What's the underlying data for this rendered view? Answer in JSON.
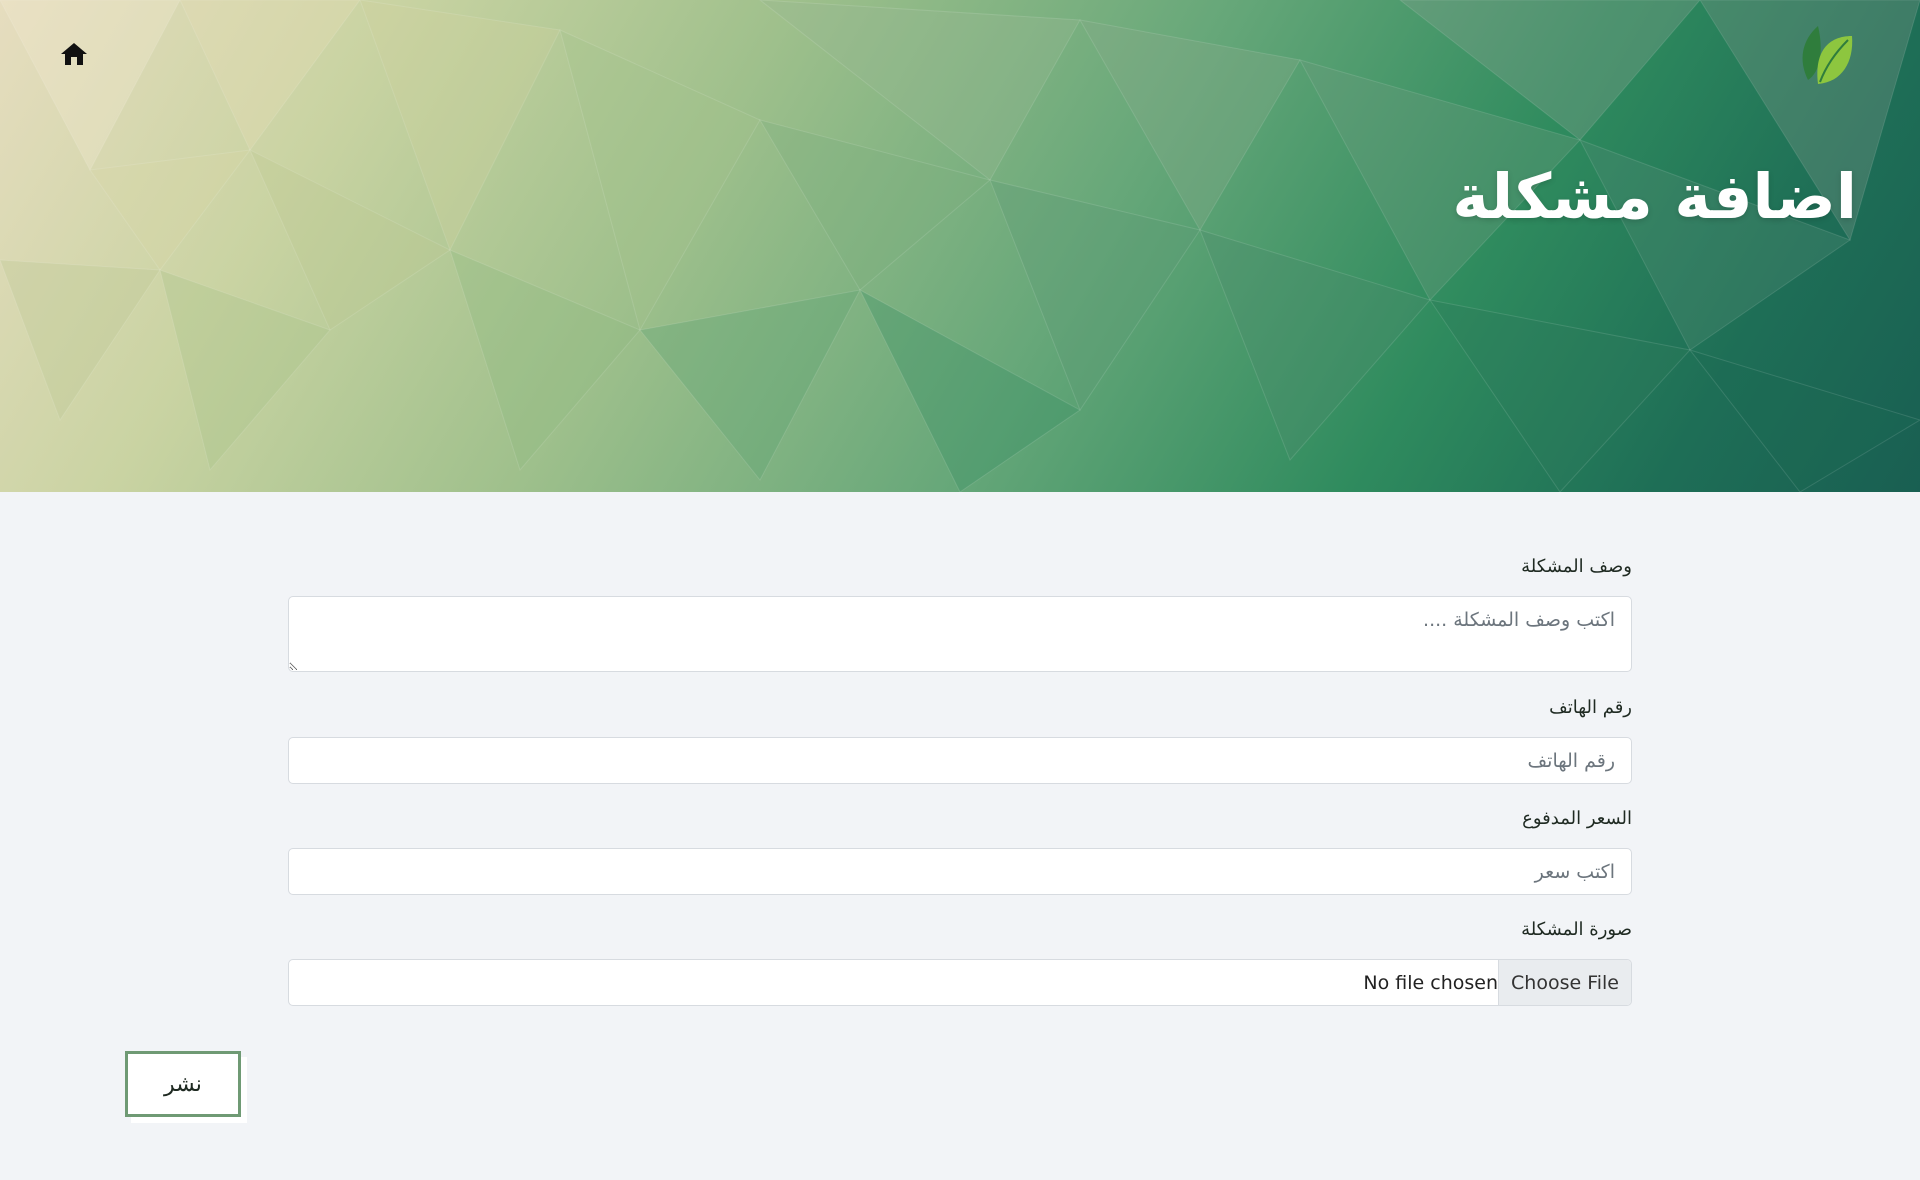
{
  "header": {
    "title": "اضافة مشكلة",
    "home_icon": "home-icon",
    "logo_icon": "leaf-logo-icon"
  },
  "form": {
    "description": {
      "label": "وصف المشكلة",
      "placeholder": "اكتب وصف المشكلة ....",
      "value": ""
    },
    "phone": {
      "label": "رقم الهاتف",
      "placeholder": "رقم الهاتف",
      "value": ""
    },
    "price": {
      "label": "السعر المدفوع",
      "placeholder": "اكتب سعر",
      "value": ""
    },
    "image": {
      "label": "صورة المشكلة",
      "button_label": "Choose File",
      "status": "No file chosen"
    },
    "submit_label": "نشر"
  },
  "colors": {
    "page_background": "#f2f4f7",
    "accent_green": "#2f8b5e",
    "submit_border": "#6f9a74"
  }
}
